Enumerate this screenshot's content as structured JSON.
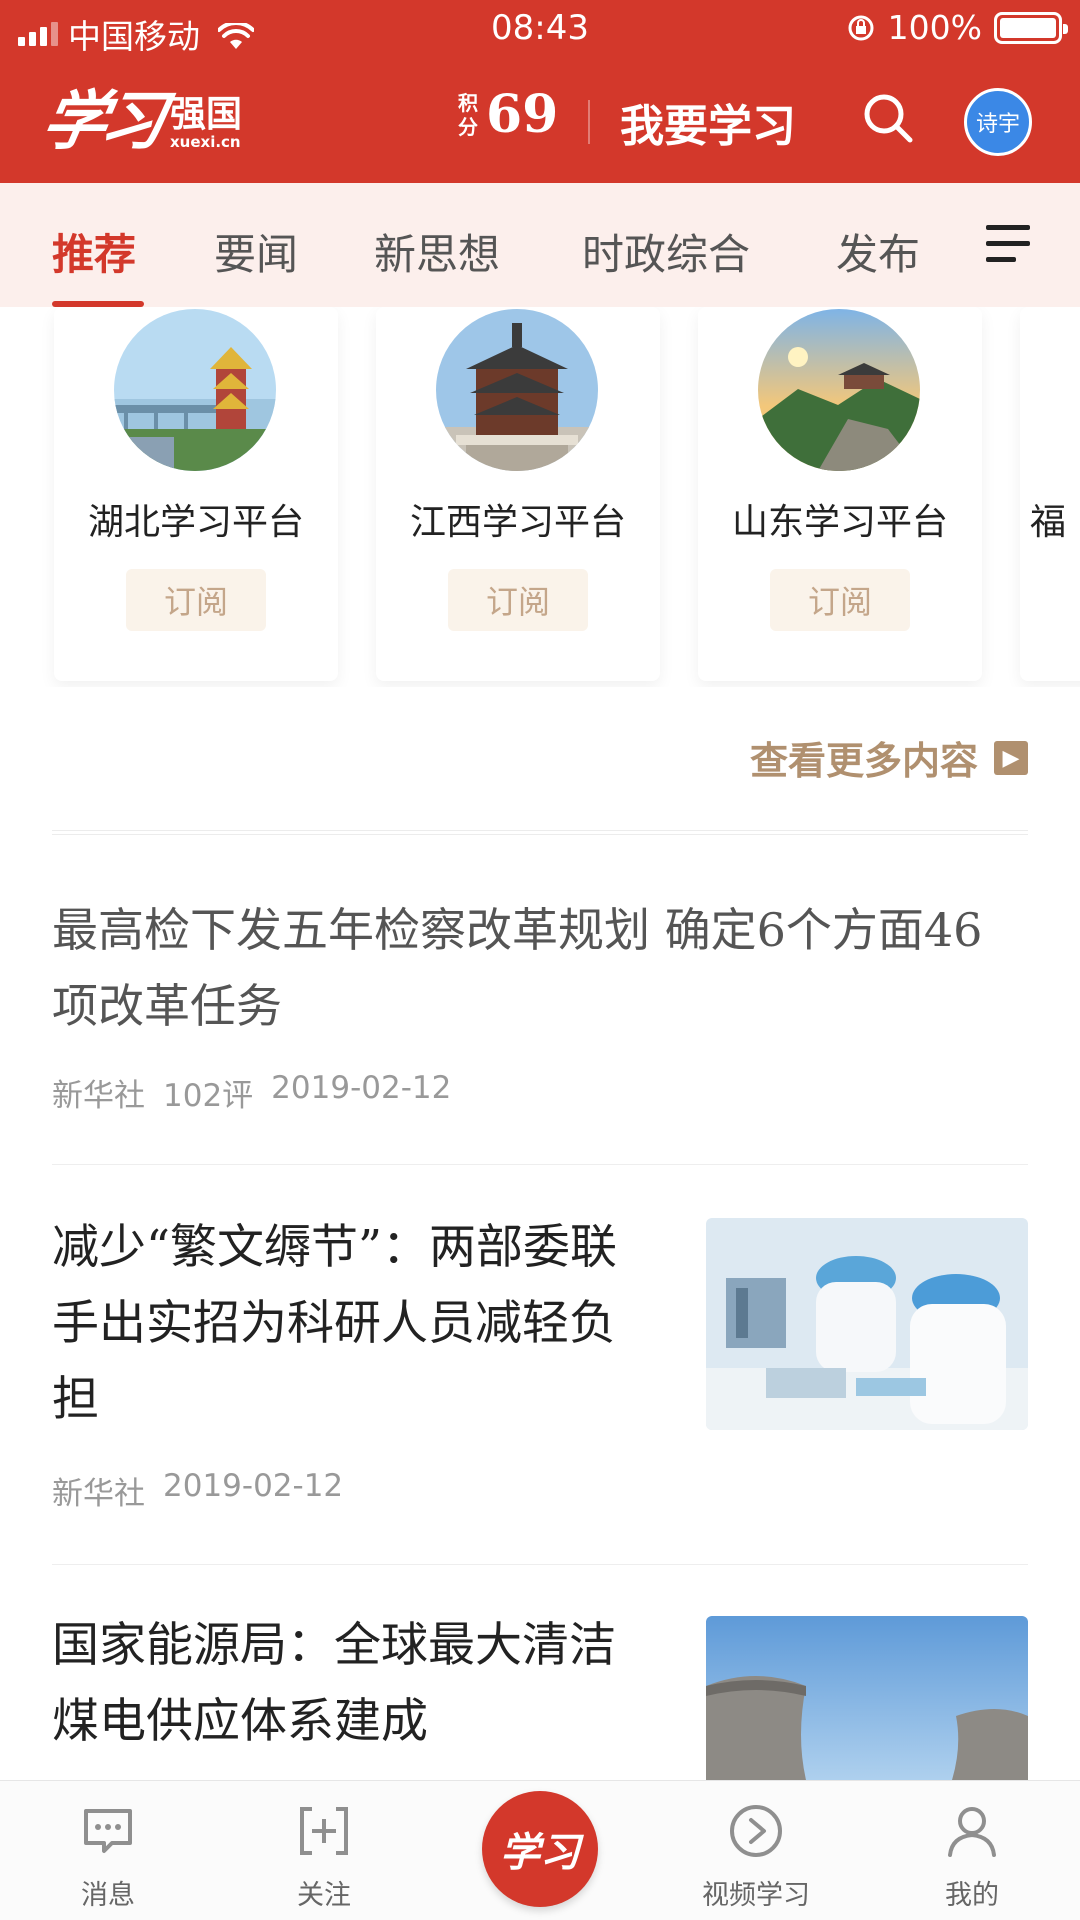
{
  "status_bar": {
    "carrier": "中国移动",
    "time": "08:43",
    "battery": "100%",
    "battery_level": 1.0
  },
  "header": {
    "logo_script": "学习",
    "logo_name": "强国",
    "logo_url": "xuexi.cn",
    "points_label": "积分",
    "points_value": "69",
    "study_button": "我要学习",
    "avatar_text": "诗宇",
    "brand_color": "#d3382b"
  },
  "tabs": [
    {
      "label": "推荐",
      "active": true
    },
    {
      "label": "要闻",
      "active": false
    },
    {
      "label": "新思想",
      "active": false
    },
    {
      "label": "时政综合",
      "active": false
    },
    {
      "label": "发布",
      "active": false
    }
  ],
  "platforms": [
    {
      "name": "湖北学习平台",
      "subscribe": "订阅"
    },
    {
      "name": "江西学习平台",
      "subscribe": "订阅"
    },
    {
      "name": "山东学习平台",
      "subscribe": "订阅"
    },
    {
      "name": "福"
    }
  ],
  "more_link": "查看更多内容",
  "news": [
    {
      "title": "最高检下发五年检察改革规划  确定6个方面46项改革任务",
      "source": "新华社",
      "comments": "102评",
      "date": "2019-02-12"
    },
    {
      "title": "减少“繁文缛节”：两部委联手出实招为科研人员减轻负担",
      "source": "新华社",
      "date": "2019-02-12"
    },
    {
      "title": "国家能源局：全球最大清洁煤电供应体系建成"
    }
  ],
  "bottom_nav": {
    "messages": "消息",
    "follow": "关注",
    "center": "学习",
    "video": "视频学习",
    "mine": "我的"
  }
}
